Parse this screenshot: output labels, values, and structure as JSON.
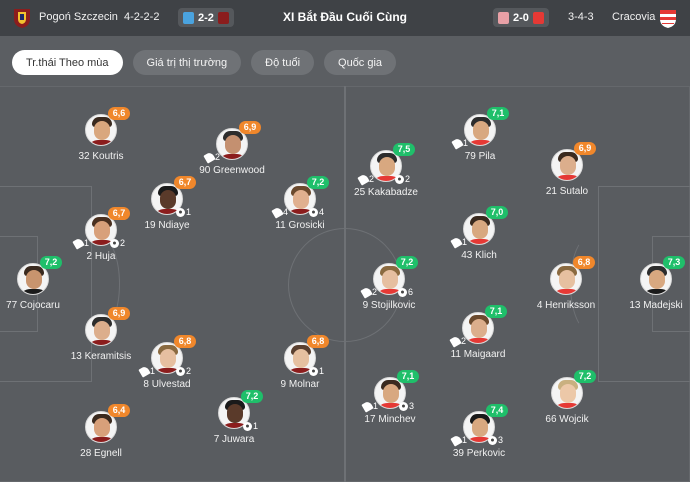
{
  "header": {
    "title": "XI Bắt Đầu Cuối Cùng",
    "home": {
      "name": "Pogoń Szczecin",
      "formation": "4-2-2-2",
      "last_score": "2-2",
      "crest_color": "#8b1d1d",
      "crest_accent": "#f2c230"
    },
    "away": {
      "name": "Cracovia",
      "formation": "3-4-3",
      "last_score": "2-0",
      "crest_color": "#e53935",
      "crest_accent": "#ffffff"
    }
  },
  "tabs": [
    {
      "label": "Tr.thái Theo mùa",
      "active": true
    },
    {
      "label": "Giá trị thị trường",
      "active": false
    },
    {
      "label": "Độ tuổi",
      "active": false
    },
    {
      "label": "Quốc gia",
      "active": false
    }
  ],
  "colors": {
    "rating_orange": "#f0872b",
    "rating_green": "#1fbf6a",
    "pitch": "#595c60"
  },
  "players": [
    {
      "name": "32 Koutris",
      "rating": "6,6",
      "rating_color": "orange",
      "stats": []
    },
    {
      "name": "90 Greenwood",
      "rating": "6,9",
      "rating_color": "orange",
      "stats": [
        {
          "icon": "boot-icon",
          "value": "2"
        }
      ]
    },
    {
      "name": "19 Ndiaye",
      "rating": "6,7",
      "rating_color": "orange",
      "stats": [
        {
          "icon": "ball-icon",
          "value": "1"
        }
      ]
    },
    {
      "name": "11 Grosicki",
      "rating": "7,2",
      "rating_color": "green",
      "stats": [
        {
          "icon": "boot-icon",
          "value": "4"
        },
        {
          "icon": "ball-icon",
          "value": "4"
        }
      ]
    },
    {
      "name": "2 Huja",
      "rating": "6,7",
      "rating_color": "orange",
      "stats": [
        {
          "icon": "boot-icon",
          "value": "1"
        },
        {
          "icon": "ball-icon",
          "value": "2"
        }
      ]
    },
    {
      "name": "77 Cojocaru",
      "rating": "7,2",
      "rating_color": "green",
      "stats": []
    },
    {
      "name": "13 Keramitsis",
      "rating": "6,9",
      "rating_color": "orange",
      "stats": []
    },
    {
      "name": "8 Ulvestad",
      "rating": "6,8",
      "rating_color": "orange",
      "stats": [
        {
          "icon": "boot-icon",
          "value": "1"
        },
        {
          "icon": "ball-icon",
          "value": "2"
        }
      ]
    },
    {
      "name": "9 Molnar",
      "rating": "6,8",
      "rating_color": "orange",
      "stats": [
        {
          "icon": "ball-icon",
          "value": "1"
        }
      ]
    },
    {
      "name": "7 Juwara",
      "rating": "7,2",
      "rating_color": "green",
      "stats": [
        {
          "icon": "ball-icon",
          "value": "1"
        }
      ]
    },
    {
      "name": "28 Egnell",
      "rating": "6,4",
      "rating_color": "orange",
      "stats": []
    },
    {
      "name": "79 Pila",
      "rating": "7,1",
      "rating_color": "green",
      "stats": [
        {
          "icon": "boot-icon",
          "value": "1"
        }
      ]
    },
    {
      "name": "25 Kakabadze",
      "rating": "7,5",
      "rating_color": "green",
      "stats": [
        {
          "icon": "boot-icon",
          "value": "2"
        },
        {
          "icon": "ball-icon",
          "value": "2"
        }
      ]
    },
    {
      "name": "21 Sutalo",
      "rating": "6,9",
      "rating_color": "orange",
      "stats": []
    },
    {
      "name": "43 Klich",
      "rating": "7,0",
      "rating_color": "green",
      "stats": [
        {
          "icon": "boot-icon",
          "value": "1"
        }
      ]
    },
    {
      "name": "9 Stojilkovic",
      "rating": "7,2",
      "rating_color": "green",
      "stats": [
        {
          "icon": "boot-icon",
          "value": "2"
        },
        {
          "icon": "ball-icon",
          "value": "6"
        }
      ]
    },
    {
      "name": "4 Henriksson",
      "rating": "6,8",
      "rating_color": "orange",
      "stats": []
    },
    {
      "name": "13 Madejski",
      "rating": "7,3",
      "rating_color": "green",
      "stats": []
    },
    {
      "name": "11 Maigaard",
      "rating": "7,1",
      "rating_color": "green",
      "stats": [
        {
          "icon": "boot-icon",
          "value": "2"
        }
      ]
    },
    {
      "name": "17 Minchev",
      "rating": "7,1",
      "rating_color": "green",
      "stats": [
        {
          "icon": "boot-icon",
          "value": "1"
        },
        {
          "icon": "ball-icon",
          "value": "3"
        }
      ]
    },
    {
      "name": "66 Wojcik",
      "rating": "7,2",
      "rating_color": "green",
      "stats": []
    },
    {
      "name": "39 Perkovic",
      "rating": "7,4",
      "rating_color": "green",
      "stats": [
        {
          "icon": "boot-icon",
          "value": "1"
        },
        {
          "icon": "ball-icon",
          "value": "3"
        }
      ]
    }
  ]
}
